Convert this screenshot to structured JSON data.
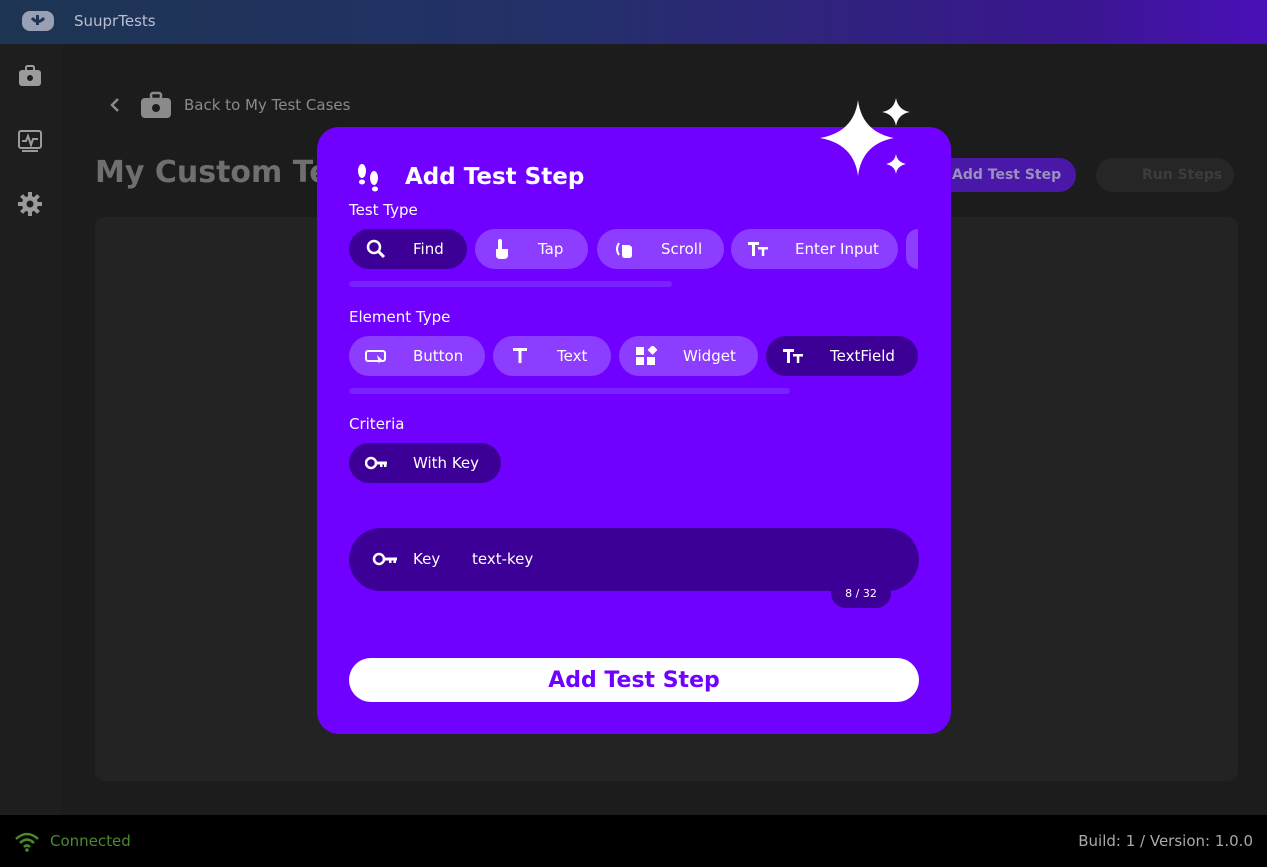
{
  "app": {
    "title": "SuuprTests"
  },
  "page": {
    "back_label": "Back to My Test Cases",
    "title": "My Custom Test",
    "add_step_button": "Add Test Step",
    "run_steps_button": "Run Steps"
  },
  "modal": {
    "title": "Add Test Step",
    "test_type": {
      "label": "Test Type",
      "options": [
        {
          "label": "Find",
          "icon": "search-icon",
          "selected": true
        },
        {
          "label": "Tap",
          "icon": "tap-icon",
          "selected": false
        },
        {
          "label": "Scroll",
          "icon": "scroll-icon",
          "selected": false
        },
        {
          "label": "Enter Input",
          "icon": "text-format-icon",
          "selected": false
        }
      ]
    },
    "element_type": {
      "label": "Element Type",
      "options": [
        {
          "label": "Button",
          "icon": "button-icon",
          "selected": false
        },
        {
          "label": "Text",
          "icon": "text-icon",
          "selected": false
        },
        {
          "label": "Widget",
          "icon": "widget-icon",
          "selected": false
        },
        {
          "label": "TextField",
          "icon": "text-format-icon",
          "selected": true
        }
      ]
    },
    "criteria": {
      "label": "Criteria",
      "options": [
        {
          "label": "With Key",
          "icon": "key-icon",
          "selected": true
        }
      ]
    },
    "key_field": {
      "label": "Key",
      "value": "text-key",
      "counter": "8 / 32"
    },
    "submit_label": "Add Test Step"
  },
  "status": {
    "connection": "Connected",
    "build": "Build: 1 / Version: 1.0.0"
  },
  "colors": {
    "modal": "#7000ff",
    "chip": "#8c3dff",
    "chip_selected": "#3d0096",
    "connected": "#4b8a2a"
  }
}
